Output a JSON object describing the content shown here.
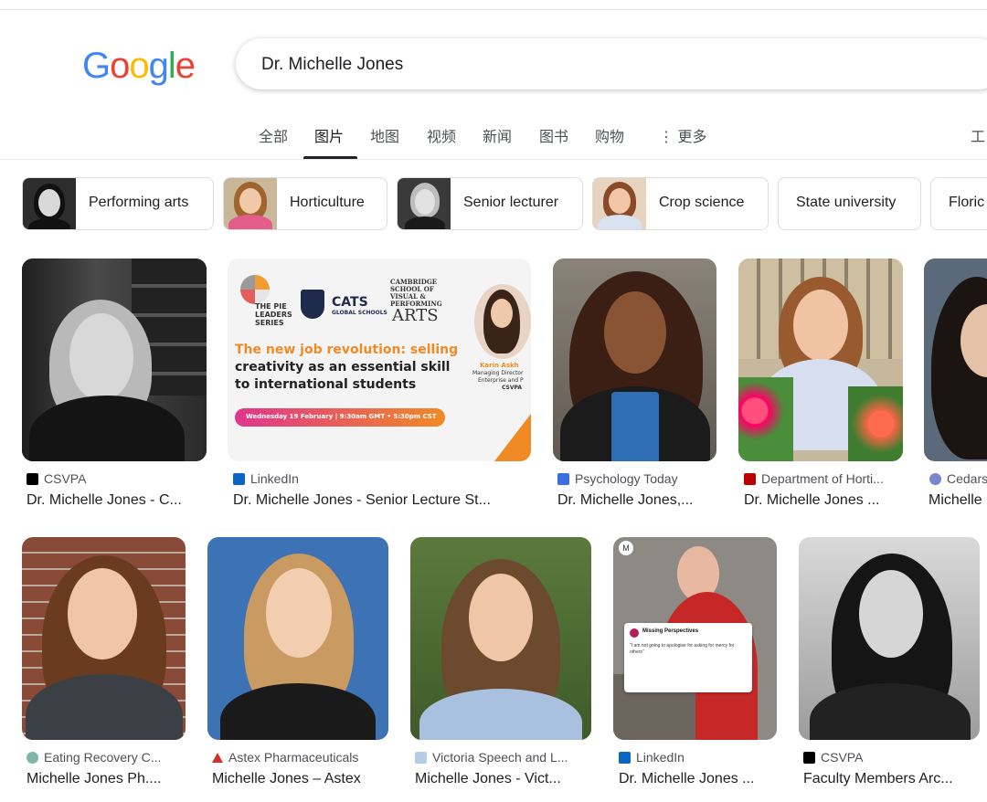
{
  "search": {
    "query": "Dr. Michelle Jones"
  },
  "logo": {
    "letters": [
      "G",
      "o",
      "o",
      "g",
      "l",
      "e"
    ],
    "colors": [
      "#4285F4",
      "#EA4335",
      "#FBBC05",
      "#4285F4",
      "#34A853",
      "#EA4335"
    ]
  },
  "tabs": {
    "all": "全部",
    "images": "图片",
    "maps": "地图",
    "videos": "视频",
    "news": "新闻",
    "books": "图书",
    "shopping": "购物",
    "more": "更多",
    "tools": "工"
  },
  "chips": [
    {
      "label": "Performing arts"
    },
    {
      "label": "Horticulture"
    },
    {
      "label": "Senior lecturer"
    },
    {
      "label": "Crop science"
    },
    {
      "label": "State university"
    },
    {
      "label": "Floric"
    }
  ],
  "results_row1": [
    {
      "source": "CSVPA",
      "title": "Dr. Michelle Jones - C...",
      "icon": "csvpa-icon"
    },
    {
      "source": "LinkedIn",
      "title": "Dr. Michelle Jones - Senior Lecture St...",
      "icon": "linkedin-icon"
    },
    {
      "source": "Psychology Today",
      "title": "Dr. Michelle Jones,...",
      "icon": "psychology-today-icon"
    },
    {
      "source": "Department of Horti...",
      "title": "Dr. Michelle Jones ...",
      "icon": "ohio-state-icon"
    },
    {
      "source": "Cedars",
      "title": "Michelle",
      "icon": "cedars-icon"
    }
  ],
  "results_row2": [
    {
      "source": "Eating Recovery C...",
      "title": "Michelle Jones Ph....",
      "icon": "eating-recovery-icon"
    },
    {
      "source": "Astex Pharmaceuticals",
      "title": "Michelle Jones – Astex",
      "icon": "astex-icon"
    },
    {
      "source": "Victoria Speech and L...",
      "title": "Michelle Jones - Vict...",
      "icon": "victoria-speech-icon"
    },
    {
      "source": "LinkedIn",
      "title": "Dr. Michelle Jones ...",
      "icon": "linkedin-icon"
    },
    {
      "source": "CSVPA",
      "title": "Faculty Members Arc...",
      "icon": "csvpa-icon"
    }
  ],
  "banner": {
    "series": "THE PIE LEADERS SERIES",
    "cats": "CATS",
    "cats_sub": "GLOBAL SCHOOLS",
    "cambridge": "CAMBRIDGE SCHOOL OF VISUAL & PERFORMING",
    "arts": "ARTS",
    "headline_1": "The new job revolution: selling",
    "headline_2": "creativity as an essential skill",
    "headline_3": "to international students",
    "date": "Wednesday 19 February | 9:30am GMT • 5:30pm CST",
    "speaker_name": "Karin Askh",
    "speaker_role_1": "Managing Director",
    "speaker_role_2": "Enterprise and P",
    "speaker_org": "CSVPA"
  },
  "tweet": {
    "account": "Missing Perspectives",
    "text": "\"I am not going to apologise for asking for mercy for others\""
  }
}
